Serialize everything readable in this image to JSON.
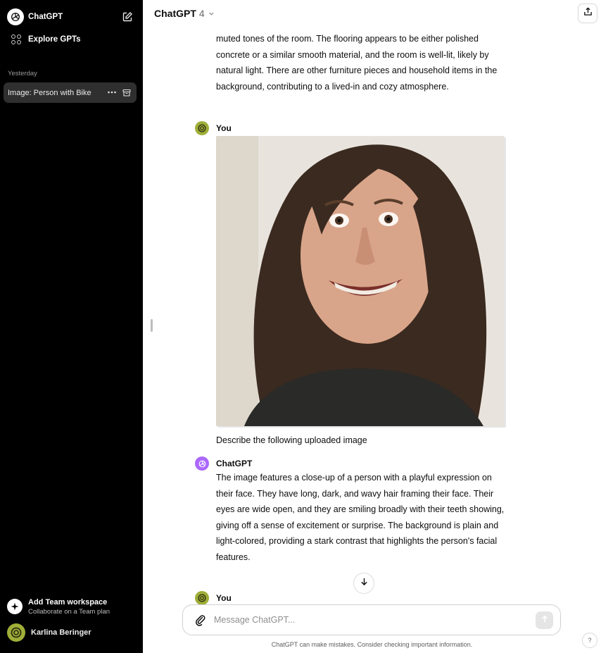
{
  "sidebar": {
    "app_name": "ChatGPT",
    "explore_label": "Explore GPTs",
    "section_label": "Yesterday",
    "history": [
      {
        "label": "Image: Person with Bike"
      }
    ],
    "team": {
      "title": "Add Team workspace",
      "subtitle": "Collaborate on a Team plan"
    },
    "user": {
      "name": "Karlina Beringer"
    }
  },
  "header": {
    "model_name": "ChatGPT",
    "model_version": "4"
  },
  "conversation": {
    "prev_assistant_tail": "muted tones of the room. The flooring appears to be either polished concrete or a similar smooth material, and the room is well-lit, likely by natural light. There are other furniture pieces and household items in the background, contributing to a lived-in and cozy atmosphere.",
    "user_msg_1": {
      "author": "You",
      "text": "Describe the following uploaded image"
    },
    "assistant_msg": {
      "author": "ChatGPT",
      "text": "The image features a close-up of a person with a playful expression on their face. They have long, dark, and wavy hair framing their face. Their eyes are wide open, and they are smiling broadly with their teeth showing, giving off a sense of excitement or surprise. The background is plain and light-colored, providing a stark contrast that highlights the person's facial features."
    },
    "user_msg_2": {
      "author": "You"
    }
  },
  "composer": {
    "placeholder": "Message ChatGPT..."
  },
  "footer": {
    "disclaimer": "ChatGPT can make mistakes. Consider checking important information.",
    "help": "?"
  },
  "icons": {
    "new_chat": "edit-icon",
    "explore": "grid-icon",
    "share": "share-icon",
    "attach": "paperclip-icon",
    "send": "arrow-up-icon",
    "scroll": "arrow-down-icon"
  },
  "colors": {
    "sidebar_bg": "#000000",
    "active_item_bg": "#2f2f2f",
    "assistant_avatar": "#ab68ff",
    "user_avatar": "#9fae38"
  }
}
